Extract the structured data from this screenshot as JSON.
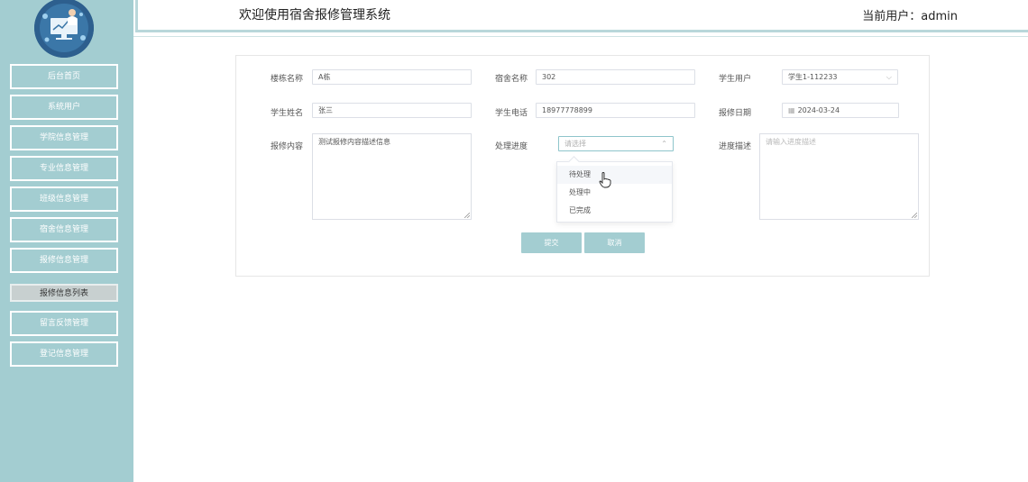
{
  "header": {
    "system_title": "欢迎使用宿舍报修管理系统",
    "current_user": "当前用户：admin"
  },
  "sidebar": {
    "items": [
      {
        "label": "后台首页"
      },
      {
        "label": "系统用户"
      },
      {
        "label": "学院信息管理"
      },
      {
        "label": "专业信息管理"
      },
      {
        "label": "班级信息管理"
      },
      {
        "label": "宿舍信息管理"
      },
      {
        "label": "报修信息管理"
      },
      {
        "label": "报修信息列表"
      },
      {
        "label": "留言反馈管理"
      },
      {
        "label": "登记信息管理"
      }
    ],
    "active_index": 7,
    "accent_color": "#a3cdd1"
  },
  "form": {
    "building": {
      "label": "楼栋名称",
      "value": "A栋"
    },
    "dorm": {
      "label": "宿舍名称",
      "value": "302"
    },
    "student_user": {
      "label": "学生用户",
      "value": "学生1-112233"
    },
    "student_name": {
      "label": "学生姓名",
      "value": "张三"
    },
    "student_phone": {
      "label": "学生电话",
      "value": "18977778899"
    },
    "repair_date": {
      "label": "报修日期",
      "value": "2024-03-24"
    },
    "repair_content": {
      "label": "报修内容",
      "value": "测试报修内容描述信息"
    },
    "progress": {
      "label": "处理进度",
      "placeholder": "请选择",
      "options": [
        "待处理",
        "处理中",
        "已完成"
      ],
      "hovered_option": "待处理"
    },
    "progress_desc": {
      "label": "进度描述",
      "placeholder": "请输入进度描述"
    }
  },
  "buttons": {
    "submit": "提交",
    "cancel": "取消"
  },
  "icons": {
    "avatar": "doctor-avatar-icon",
    "calendar": "calendar-icon",
    "chevron": "chevron-down-icon",
    "cursor": "hand-pointer-icon"
  }
}
